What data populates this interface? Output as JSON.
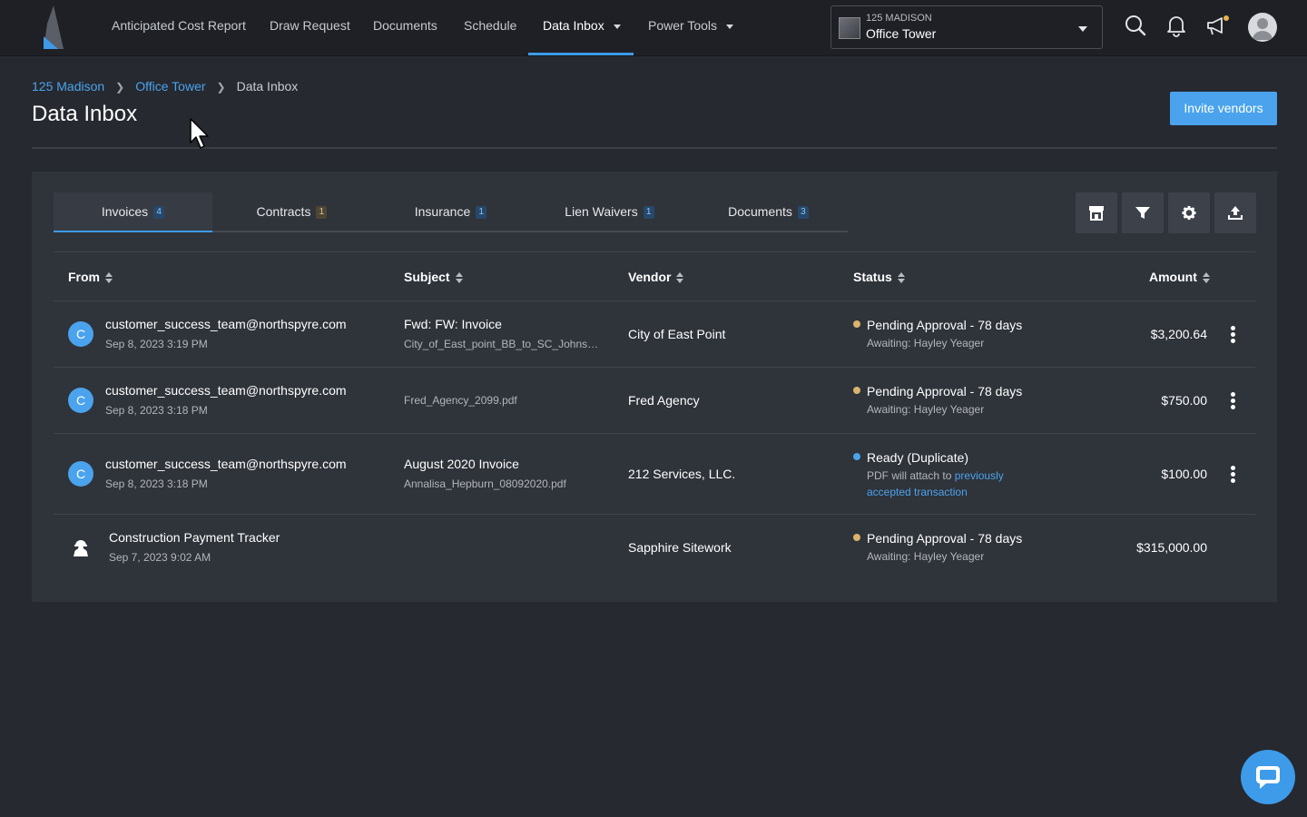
{
  "nav": {
    "items": [
      {
        "label": "Anticipated Cost Report"
      },
      {
        "label": "Draw Request"
      },
      {
        "label": "Documents"
      },
      {
        "label": "Schedule"
      },
      {
        "label": "Data Inbox",
        "active": true,
        "dropdown": true
      },
      {
        "label": "Power Tools",
        "dropdown": true
      }
    ],
    "project": {
      "subtitle": "125 MADISON",
      "name": "Office Tower"
    },
    "icons": [
      "search-icon",
      "bell-icon",
      "megaphone-icon",
      "user-avatar"
    ],
    "accent_color": "#3d9be9"
  },
  "breadcrumb": [
    "125 Madison",
    "Office Tower",
    "Data Inbox"
  ],
  "page_title": "Data Inbox",
  "invite_label": "Invite vendors",
  "tabs": [
    {
      "label": "Invoices",
      "count": "4",
      "active": true
    },
    {
      "label": "Contracts",
      "count": "1"
    },
    {
      "label": "Insurance",
      "count": "1"
    },
    {
      "label": "Lien Waivers",
      "count": "1"
    },
    {
      "label": "Documents",
      "count": "3"
    }
  ],
  "toolbar_icons": [
    "store-icon",
    "filter-icon",
    "gear-icon",
    "upload-icon"
  ],
  "columns": {
    "from": "From",
    "subject": "Subject",
    "vendor": "Vendor",
    "status": "Status",
    "amount": "Amount"
  },
  "rows": [
    {
      "avatar": "C",
      "from": "customer_success_team@northspyre.com",
      "date": "Sep 8, 2023 3:19 PM",
      "subject": "Fwd: FW: Invoice",
      "file": "City_of_East_point_BB_to_SC_Johnson...",
      "vendor": "City of East Point",
      "status": "Pending Approval - 78 days",
      "status_sub": "Awaiting: Hayley Yeager",
      "status_color": "#d9b46c",
      "amount": "$3,200.64"
    },
    {
      "avatar": "C",
      "from": "customer_success_team@northspyre.com",
      "date": "Sep 8, 2023 3:18 PM",
      "subject": "",
      "file": "Fred_Agency_2099.pdf",
      "vendor": "Fred Agency",
      "status": "Pending Approval - 78 days",
      "status_sub": "Awaiting: Hayley Yeager",
      "status_color": "#d9b46c",
      "amount": "$750.00"
    },
    {
      "avatar": "C",
      "from": "customer_success_team@northspyre.com",
      "date": "Sep 8, 2023 3:18 PM",
      "subject": "August 2020 Invoice",
      "file": "Annalisa_Hepburn_08092020.pdf",
      "vendor": "212 Services, LLC.",
      "status": "Ready (Duplicate)",
      "status_sub_prefix": "PDF will attach to",
      "status_sub_link_1": "previously",
      "status_sub_link_2": "accepted transaction",
      "status_color": "#4aa3ec",
      "amount": "$100.00"
    },
    {
      "avatar_icon": "worker-icon",
      "from": "Construction Payment Tracker",
      "date": "Sep 7, 2023 9:02 AM",
      "subject": "",
      "file": "",
      "vendor": "Sapphire Sitework",
      "status": "Pending Approval - 78 days",
      "status_sub": "Awaiting: Hayley Yeager",
      "status_color": "#d9b46c",
      "amount": "$315,000.00"
    }
  ]
}
